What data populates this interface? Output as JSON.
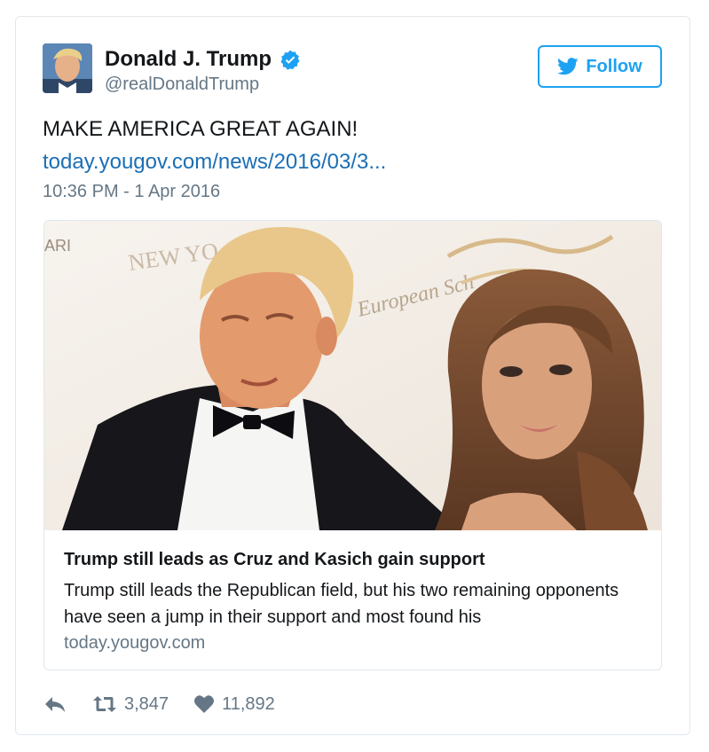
{
  "tweet": {
    "author_name": "Donald J. Trump",
    "handle": "@realDonaldTrump",
    "follow_label": "Follow",
    "text": "MAKE AMERICA GREAT AGAIN!",
    "link_text": "today.yougov.com/news/2016/03/3...",
    "timestamp": "10:36 PM - 1 Apr 2016"
  },
  "link_card": {
    "image_sign_text_1": "NEW YO",
    "image_sign_text_2": "European Sch",
    "image_sign_text_3": "ARI",
    "title": "Trump still leads as Cruz and Kasich gain support",
    "description": "Trump still leads the Republican field, but his two remaining opponents have seen a jump in their support and most found his",
    "domain": "today.yougov.com"
  },
  "actions": {
    "reply_icon": "reply-icon",
    "retweet_icon": "retweet-icon",
    "like_icon": "heart-icon",
    "retweet_count": "3,847",
    "like_count": "11,892"
  },
  "colors": {
    "accent": "#1da1f2",
    "link": "#1b6fb5",
    "muted": "#657786",
    "border": "#e1e8ed"
  }
}
